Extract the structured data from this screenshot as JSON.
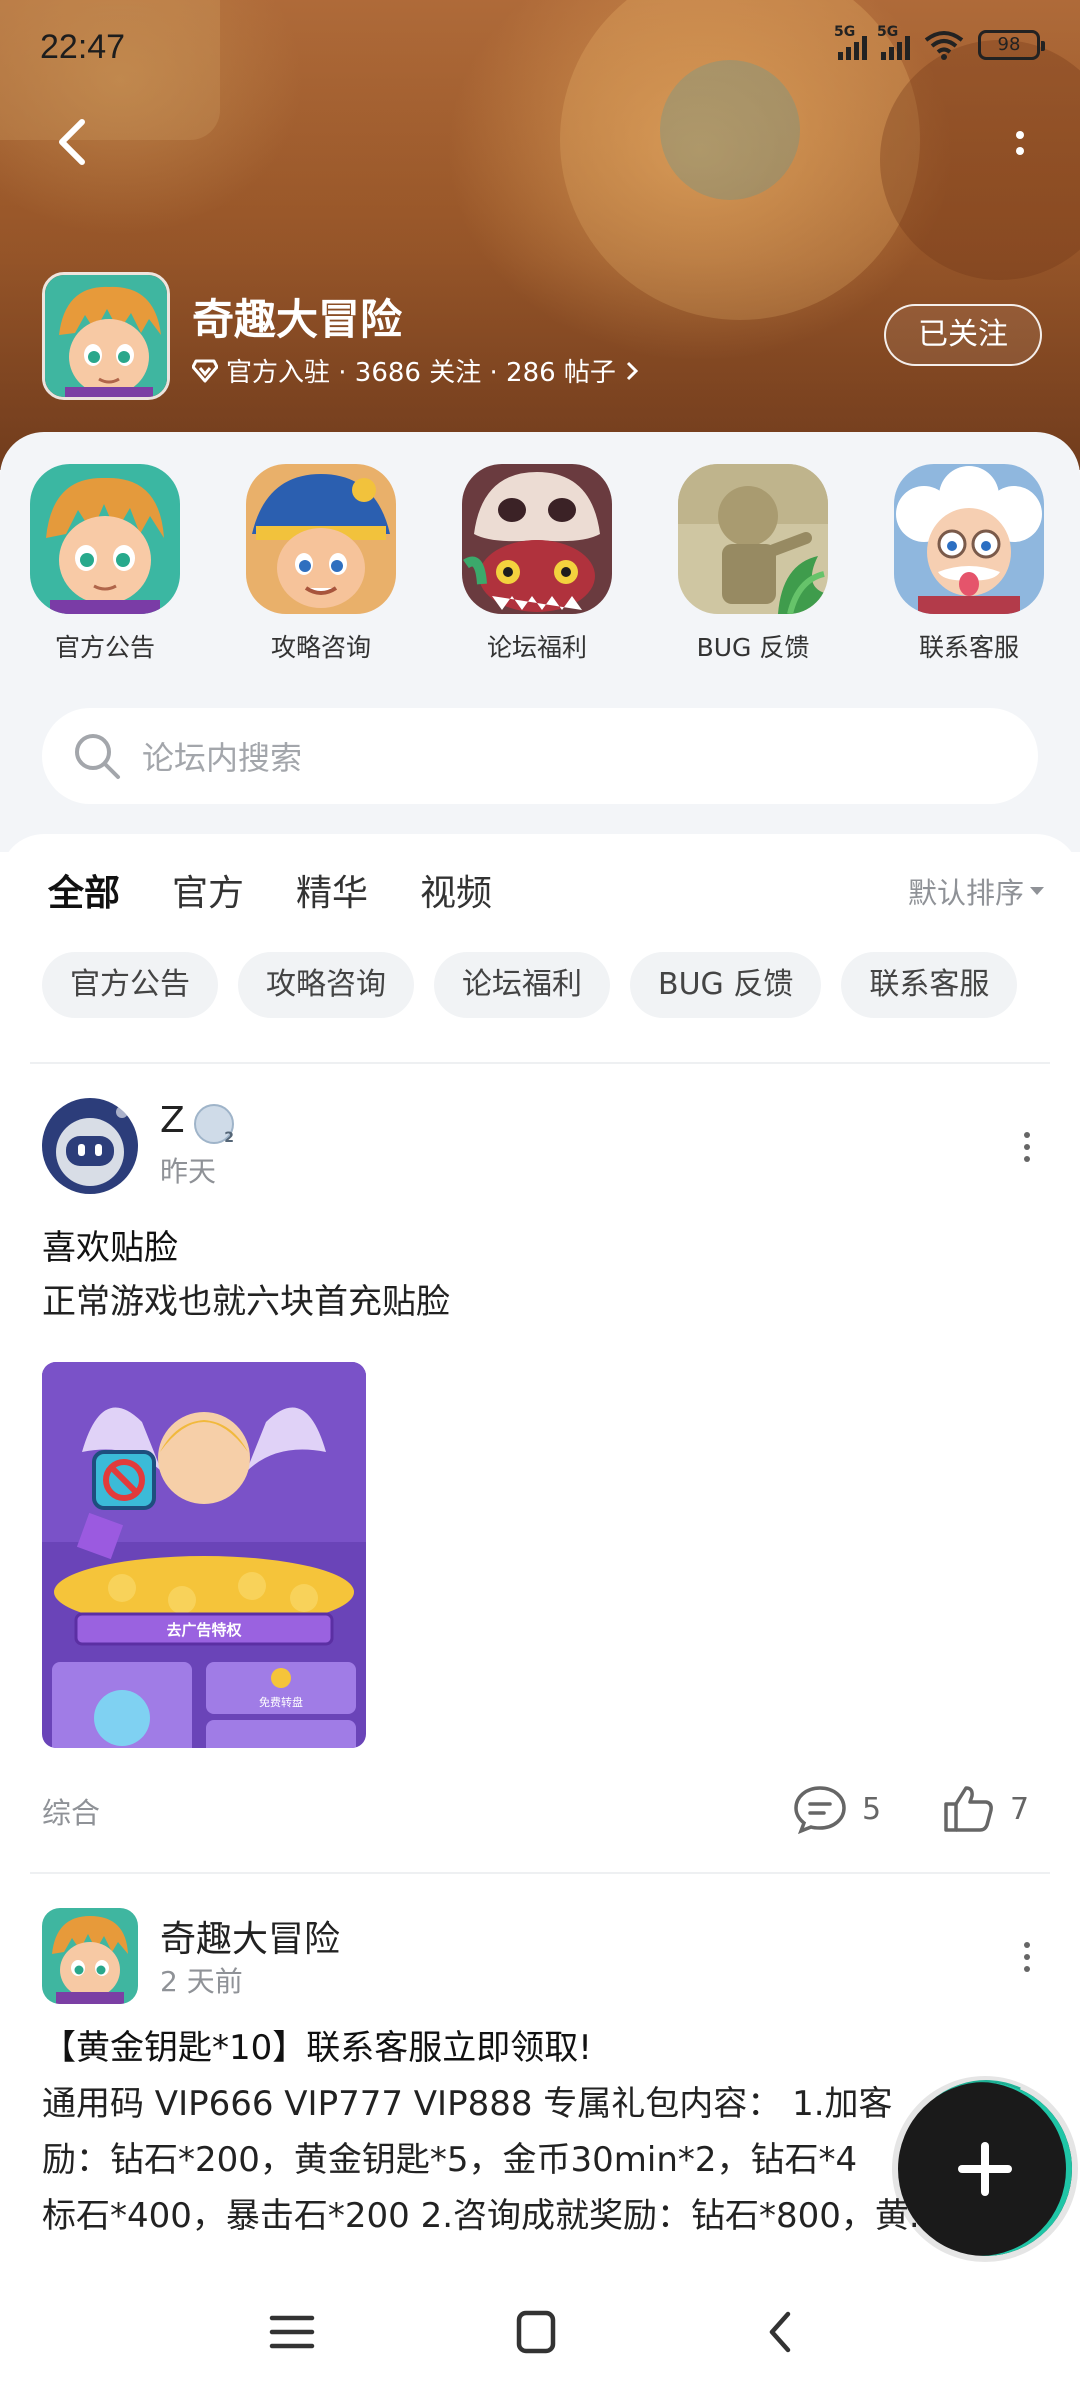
{
  "status_bar": {
    "time": "22:47",
    "network_1": "5G",
    "network_2": "5G",
    "battery": "98"
  },
  "header": {
    "app_name": "奇趣大冒险",
    "meta": "官方入驻 · 3686 关注 · 286 帖子",
    "follow_label": "已关注"
  },
  "categories": [
    {
      "label": "官方公告",
      "icon": "hero-boy-icon"
    },
    {
      "label": "攻略咨询",
      "icon": "pirate-captain-icon"
    },
    {
      "label": "论坛福利",
      "icon": "skull-monster-icon"
    },
    {
      "label": "BUG 反馈",
      "icon": "statue-icon"
    },
    {
      "label": "联系客服",
      "icon": "old-scientist-icon"
    }
  ],
  "search": {
    "placeholder": "论坛内搜索"
  },
  "tabs": [
    {
      "label": "全部"
    },
    {
      "label": "官方"
    },
    {
      "label": "精华"
    },
    {
      "label": "视频"
    }
  ],
  "sort_label": "默认排序",
  "chips": [
    {
      "label": "官方公告"
    },
    {
      "label": "攻略咨询"
    },
    {
      "label": "论坛福利"
    },
    {
      "label": "BUG 反馈"
    },
    {
      "label": "联系客服"
    }
  ],
  "posts": [
    {
      "author": "Z",
      "time": "昨天",
      "title": "喜欢贴脸",
      "body": "正常游戏也就六块首充贴脸",
      "image_caption": "去广告特权",
      "image_button": "免费转盘",
      "tag": "综合",
      "comments": "5",
      "likes": "7"
    },
    {
      "author": "奇趣大冒险",
      "time": "2 天前",
      "title": "【黄金钥匙*10】联系客服立即领取!",
      "body_line1": "通用码 VIP666 VIP777 VIP888 专属礼包内容： 1.加客",
      "body_line2": "励：钻石*200，黄金钥匙*5，金币30min*2，钻石*4",
      "body_line3": "标石*400，暴击石*200 2.咨询成就奖励：钻石*800，黄..."
    }
  ],
  "colors": {
    "accent": "#1fc5a6",
    "banner": "#a9622f",
    "panel": "#f3f5f8"
  }
}
